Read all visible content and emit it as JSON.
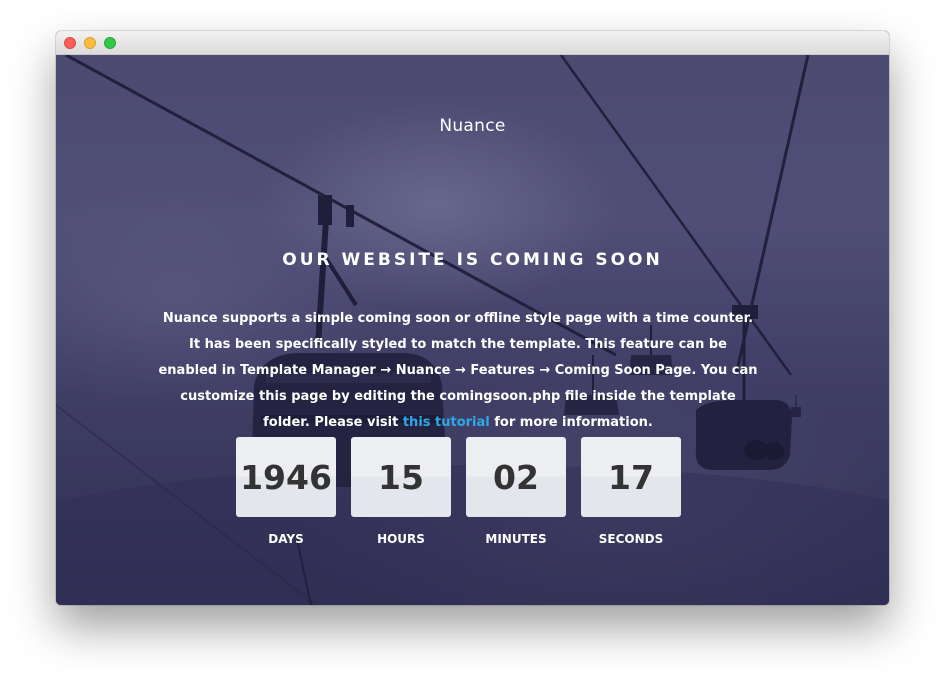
{
  "brand": "Nuance",
  "headline": "OUR WEBSITE IS COMING SOON",
  "description": {
    "text_before": "Nuance supports a simple coming soon or offline style page with a time counter. It has been specifically styled to match the template. This feature can be enabled in Template Manager → Nuance → Features → Coming Soon Page. You can customize this page by editing the comingsoon.php file inside the template folder. Please visit ",
    "link_text": "this tutorial",
    "text_after": " for more information."
  },
  "countdown": [
    {
      "value": "1946",
      "label": "DAYS"
    },
    {
      "value": "15",
      "label": "HOURS"
    },
    {
      "value": "02",
      "label": "MINUTES"
    },
    {
      "value": "17",
      "label": "SECONDS"
    }
  ],
  "colors": {
    "overlay": "#3a3858",
    "link": "#2ea8e6",
    "counter_box": "#eceef1",
    "counter_text": "#333333",
    "traffic_red": "#fc605c",
    "traffic_yellow": "#fdbc40",
    "traffic_green": "#34c84a"
  },
  "icons": [
    "close-window-icon",
    "minimize-window-icon",
    "maximize-window-icon"
  ]
}
